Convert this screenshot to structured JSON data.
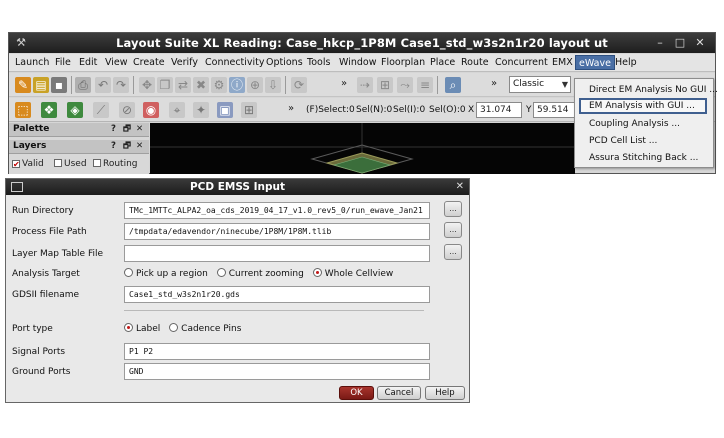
{
  "window": {
    "title": "Layout Suite XL Reading: Case_hkcp_1P8M Case1_std_w3s2n1r20 layout  ut",
    "controls": [
      "–",
      "□",
      "✕"
    ]
  },
  "menubar": [
    {
      "label": "Launch"
    },
    {
      "label": "File"
    },
    {
      "label": "Edit"
    },
    {
      "label": "View"
    },
    {
      "label": "Create"
    },
    {
      "label": "Verify"
    },
    {
      "label": "Connectivity"
    },
    {
      "label": "Options"
    },
    {
      "label": "Tools"
    },
    {
      "label": "Window"
    },
    {
      "label": "Floorplan"
    },
    {
      "label": "Place"
    },
    {
      "label": "Route"
    },
    {
      "label": "Concurrent"
    },
    {
      "label": "EMX"
    },
    {
      "label": "eWave",
      "active": true
    },
    {
      "label": "Help"
    }
  ],
  "toolbar1": {
    "overflow": "»",
    "overflow2": "»",
    "mode_combo": "Classic"
  },
  "toolbar2": {
    "overflow": "»",
    "fselect": "(F)Select:0",
    "seln": "Sel(N):0",
    "seli": "Sel(I):0",
    "selo": "Sel(O):0",
    "x_label": "X",
    "x_value": "31.074",
    "y_label": "Y",
    "y_value": "59.514"
  },
  "palette": {
    "title": "Palette",
    "layers_title": "Layers",
    "checks": [
      {
        "label": "Valid",
        "checked": true
      },
      {
        "label": "Used",
        "checked": false
      },
      {
        "label": "Routing",
        "checked": false
      }
    ],
    "head_controls": [
      "?",
      "🗗",
      "✕"
    ]
  },
  "ewave_menu": {
    "items": [
      {
        "label": "Direct EM Analysis No GUI ..."
      },
      {
        "label": "EM Analysis with GUI ...",
        "selected": true
      },
      {
        "label": "Coupling Analysis ..."
      },
      {
        "label": "PCD Cell List ..."
      },
      {
        "label": "Assura Stitching Back ..."
      }
    ]
  },
  "dialog": {
    "title": "PCD EMSS Input",
    "close": "✕",
    "run_directory": {
      "label": "Run Directory",
      "value": "TMc_1MTTc_ALPA2_oa_cds_2019_04_17_v1.0_rev5_0/run_ewave_Jan21"
    },
    "process_file": {
      "label": "Process File Path",
      "value": "/tmpdata/edavendor/ninecube/1P8M/1P8M.tlib"
    },
    "layer_map": {
      "label": "Layer Map Table File",
      "value": ""
    },
    "analysis_target": {
      "label": "Analysis Target",
      "options": [
        {
          "label": "Pick up a region",
          "selected": false
        },
        {
          "label": "Current zooming",
          "selected": false
        },
        {
          "label": "Whole Cellview",
          "selected": true
        }
      ]
    },
    "gdsii": {
      "label": "GDSII filename",
      "value": "Case1_std_w3s2n1r20.gds"
    },
    "port_type": {
      "label": "Port type",
      "options": [
        {
          "label": "Label",
          "selected": true
        },
        {
          "label": "Cadence Pins",
          "selected": false
        }
      ]
    },
    "signal_ports": {
      "label": "Signal Ports",
      "value": "P1 P2"
    },
    "ground_ports": {
      "label": "Ground Ports",
      "value": "GND"
    },
    "buttons": {
      "ok": "OK",
      "cancel": "Cancel",
      "help": "Help"
    },
    "browse_glyph": "..."
  },
  "colors": {
    "titlebar": "#1e1e1e",
    "menu_active": "#4a6fa5",
    "selected_outline": "#3f5f8f",
    "ok_button": "#8a2420",
    "radio_dot": "#c01818"
  }
}
